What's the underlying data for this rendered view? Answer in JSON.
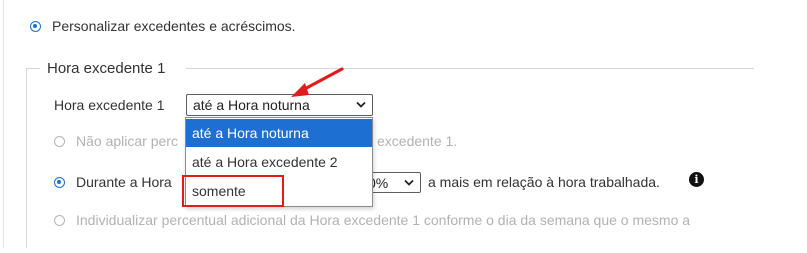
{
  "top_option": {
    "label": "Personalizar excedentes e acréscimos."
  },
  "fieldset": {
    "legend": "Hora excedente 1",
    "field_label": "Hora excedente 1",
    "select_value": "até a Hora noturna",
    "dropdown_options": [
      "até a Hora noturna",
      "até a Hora excedente 2",
      "somente"
    ],
    "selected_option_index": 0,
    "radio_1_text_left": "Não aplicar perc",
    "radio_1_text_right": "excedente 1.",
    "radio_2_text_left": "Durante a Hora",
    "radio_2_percent_suffix": "0%",
    "radio_2_text_right": "a mais em relação à hora trabalhada.",
    "radio_3_text": "Individualizar percentual adicional da Hora excedente 1 conforme o dia da semana que o mesmo a"
  },
  "colors": {
    "accent": "#1a73c9",
    "selected_option": "#1d6fd1",
    "annotation": "#e21b1b"
  },
  "icons": [
    "info-icon",
    "chevron-down-icon",
    "annotation-arrow-icon"
  ]
}
